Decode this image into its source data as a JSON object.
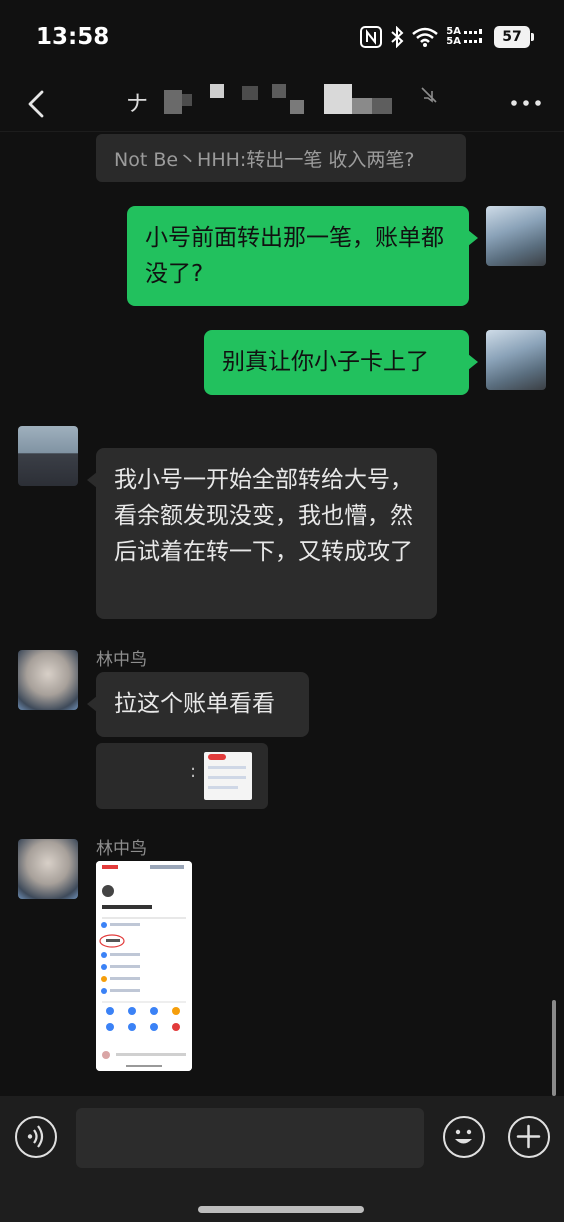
{
  "status_bar": {
    "time": "13:58",
    "network_top": "5A",
    "network_bottom": "5A",
    "battery": "57",
    "icons": [
      "nfc-icon",
      "bluetooth-icon",
      "wifi-icon",
      "signal-icon",
      "battery-icon"
    ]
  },
  "header": {
    "title_visible": "ナ",
    "icons": [
      "back-icon",
      "mute-icon",
      "more-icon"
    ]
  },
  "messages": {
    "system": "Not Be丶HHH:转出一笔 收入两笔?",
    "out_1": "小号前面转出那一笔，账单都没了?",
    "out_2": "别真让你小子卡上了",
    "in_1": "我小号一开始全部转给大号，看余额发现没变，我也懵，然后试着在转一下，又转成攻了",
    "sender_1": "林中鸟",
    "in_2": "拉这个账单看看",
    "quote_prefix": ":",
    "sender_2": "林中鸟"
  },
  "input_bar": {
    "placeholder": "",
    "icons": [
      "voice-icon",
      "emoji-icon",
      "plus-icon"
    ]
  },
  "colors": {
    "background": "#111111",
    "bubble_out": "#22c15e",
    "bubble_in": "#2c2c2c",
    "input_bar": "#1e1e1e"
  }
}
